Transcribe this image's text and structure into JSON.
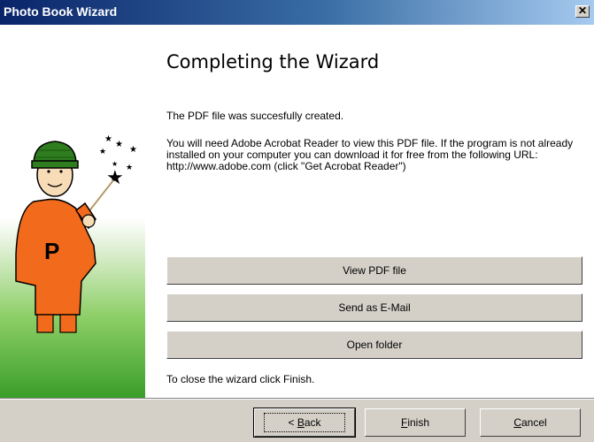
{
  "window": {
    "title": "Photo Book Wizard",
    "close_glyph": "✕"
  },
  "main": {
    "heading": "Completing the Wizard",
    "message1": "The PDF file was succesfully created.",
    "message2": "You will need Adobe Acrobat Reader to view this PDF file. If the program is not already installed on your computer you can download it for free from the following URL:",
    "message3": "http://www.adobe.com (click \"Get Acrobat Reader\")",
    "actions": {
      "view_pdf": "View PDF file",
      "send_email": "Send as E-Mail",
      "open_folder": "Open folder"
    },
    "hint": "To close the wizard click Finish."
  },
  "illustration": {
    "icon": "wizard-mascot",
    "shirt_letter": "P",
    "colors": {
      "shirt": "#f26a1b",
      "hat": "#2e7d1e",
      "sidebar_green": "#3a9e2a"
    }
  },
  "footer": {
    "back": {
      "prefix": "< ",
      "hotkey": "B",
      "rest": "ack"
    },
    "finish": {
      "hotkey": "F",
      "rest": "inish"
    },
    "cancel": {
      "hotkey": "C",
      "rest": "ancel"
    }
  }
}
